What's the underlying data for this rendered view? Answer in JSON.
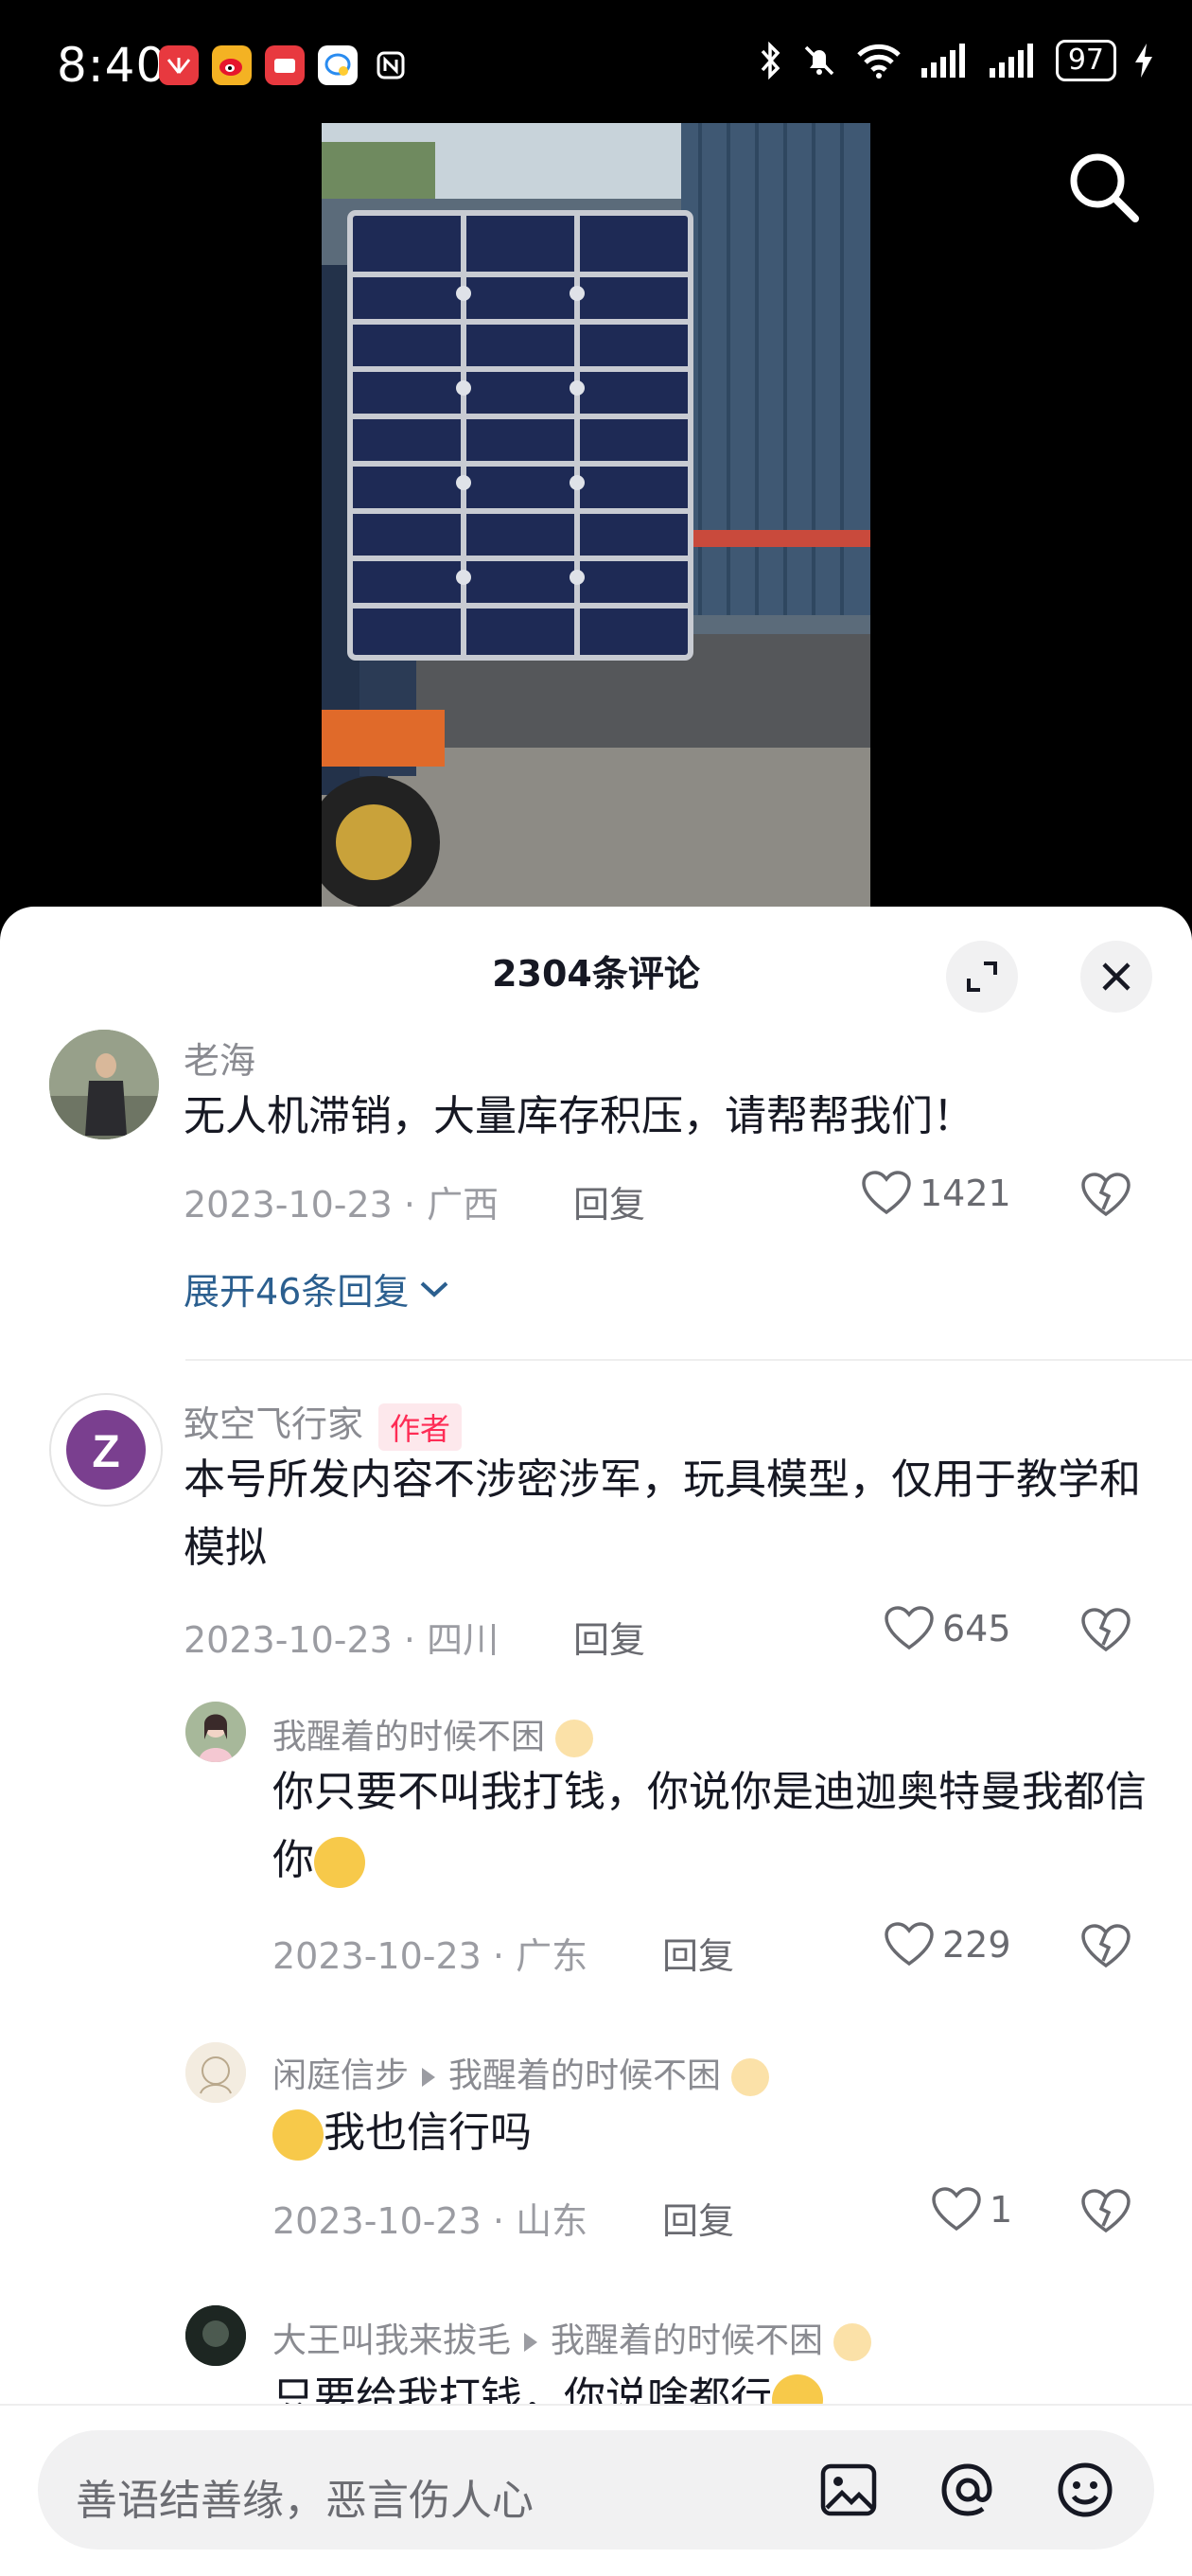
{
  "status": {
    "time": "8:40",
    "battery": "97",
    "app_icons": [
      "huawei-app-icon",
      "weibo-icon",
      "red-app-icon",
      "chat-app-icon",
      "nfc-icon"
    ]
  },
  "sheet": {
    "title": "2304条评论"
  },
  "comments": [
    {
      "user": "老海",
      "text": "无人机滞销，大量库存积压，请帮帮我们！",
      "date": "2023-10-23",
      "location": "广西",
      "reply": "回复",
      "likes": "1421",
      "expand": "展开46条回复"
    },
    {
      "user": "致空飞行家",
      "tag": "作者",
      "text": "本号所发内容不涉密涉军，玩具模型，仅用于教学和模拟",
      "date": "2023-10-23",
      "location": "四川",
      "reply": "回复",
      "likes": "645"
    }
  ],
  "replies": [
    {
      "user": "我醒着的时候不困",
      "text": "你只要不叫我打钱，你说你是迪迦奥特曼我都信你",
      "date": "2023-10-23",
      "location": "广东",
      "reply": "回复",
      "likes": "229"
    },
    {
      "user": "闲庭信步",
      "to": "我醒着的时候不困",
      "text": "我也信行吗",
      "date": "2023-10-23",
      "location": "山东",
      "reply": "回复",
      "likes": "1"
    },
    {
      "user": "大王叫我来拔毛",
      "to": "我醒着的时候不困",
      "text": "只要给我打钱，你说啥都行"
    }
  ],
  "input": {
    "placeholder": "善语结善缘，恶言伤人心"
  },
  "colors": {
    "accent_red": "#fe2c55",
    "expand_blue": "#2b5f8f"
  }
}
